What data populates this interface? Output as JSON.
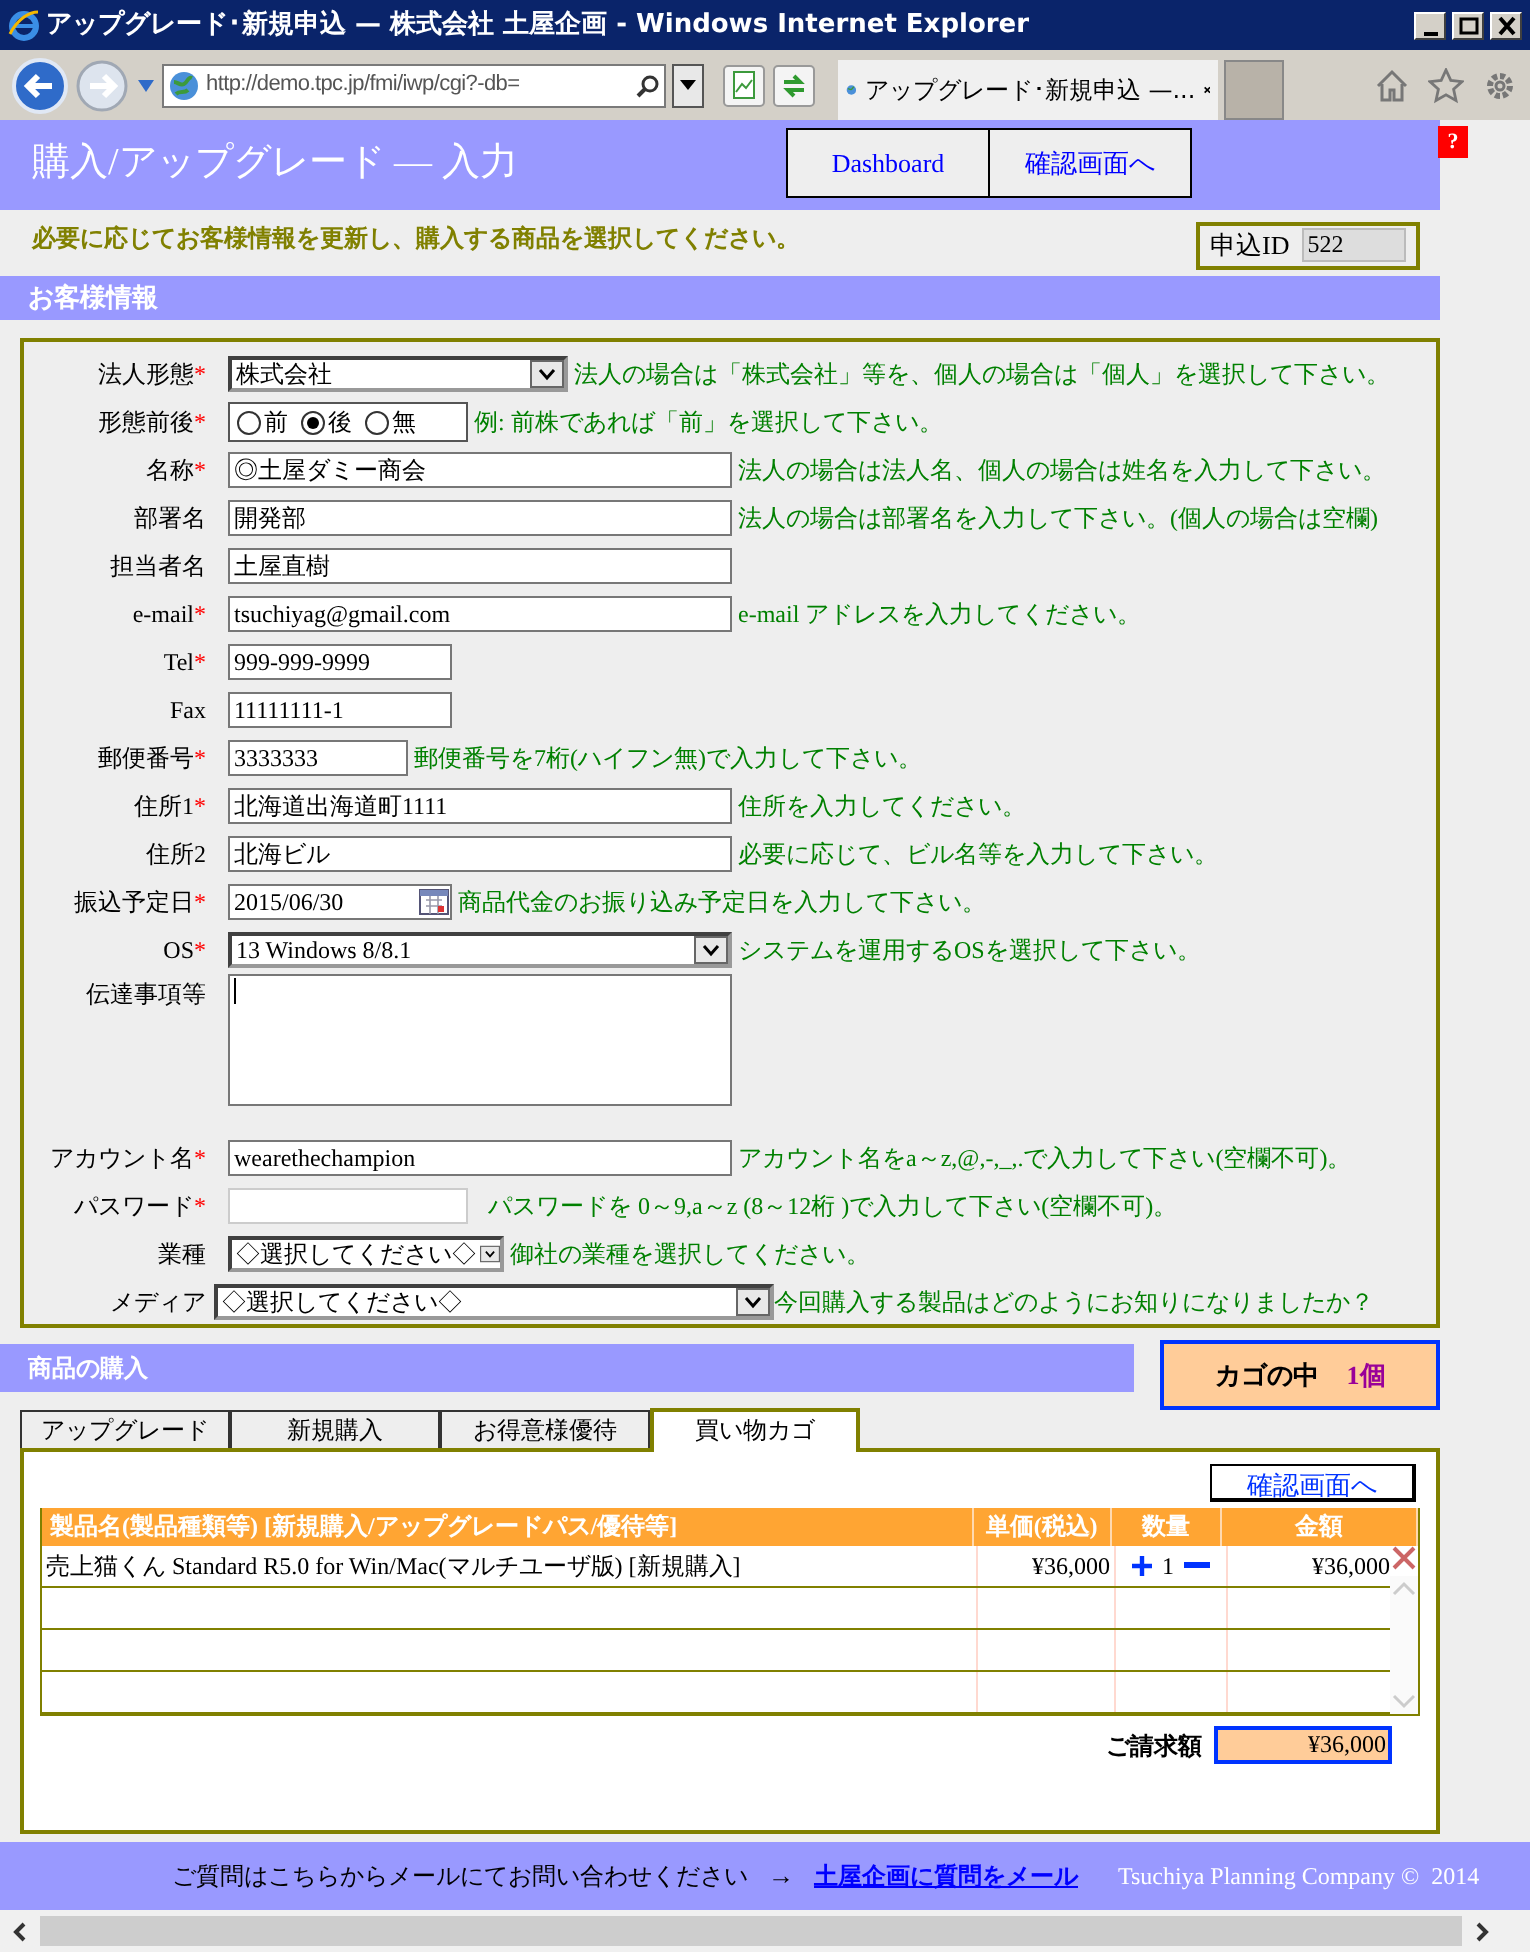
{
  "browser": {
    "window_title": "アップグレード･新規申込 — 株式会社 土屋企画 - Windows Internet Explorer",
    "address": "http://demo.tpc.jp/fmi/iwp/cgi?-db=",
    "tab_title": "アップグレード･新規申込 —..."
  },
  "header": {
    "title": "購入/アップグレード — 入力",
    "buttons": [
      "Dashboard",
      "確認画面へ"
    ],
    "help_icon": "?"
  },
  "instruction": "必要に応じてお客様情報を更新し、購入する商品を選択してください。",
  "application_id": {
    "label": "申込ID",
    "value": "522"
  },
  "customer_section": {
    "title": "お客様情報",
    "required_mark": "*",
    "fields": [
      {
        "kind": "select",
        "label": "法人形態",
        "required": true,
        "value": "株式会社",
        "hint": "法人の場合は「株式会社」等を、個人の場合は「個人」を選択して下さい。"
      },
      {
        "kind": "radio",
        "label": "形態前後",
        "required": true,
        "options": [
          {
            "label": "前",
            "selected": false
          },
          {
            "label": "後",
            "selected": true
          },
          {
            "label": "無",
            "selected": false
          }
        ],
        "hint": "例: 前株であれば「前」を選択して下さい。"
      },
      {
        "kind": "text",
        "label": "名称",
        "required": true,
        "value": "◎土屋ダミー商会",
        "hint": "法人の場合は法人名、個人の場合は姓名を入力して下さい。"
      },
      {
        "kind": "text",
        "label": "部署名",
        "required": false,
        "value": "開発部",
        "hint": "法人の場合は部署名を入力して下さい。(個人の場合は空欄)"
      },
      {
        "kind": "text",
        "label": "担当者名",
        "required": false,
        "value": "土屋直樹"
      },
      {
        "kind": "text",
        "label": "e-mail",
        "required": true,
        "value": "tsuchiyag@gmail.com",
        "hint": "e-mail アドレスを入力してください。"
      },
      {
        "kind": "text",
        "label": "Tel",
        "required": true,
        "value": "999-999-9999"
      },
      {
        "kind": "text",
        "label": "Fax",
        "required": false,
        "value": "11111111-1"
      },
      {
        "kind": "text",
        "label": "郵便番号",
        "required": true,
        "value": "3333333",
        "hint": "郵便番号を7桁(ハイフン無)で入力して下さい。"
      },
      {
        "kind": "text",
        "label": "住所1",
        "required": true,
        "value": "北海道出海道町1111",
        "hint": "住所を入力してください。"
      },
      {
        "kind": "text",
        "label": "住所2",
        "required": false,
        "value": "北海ビル",
        "hint": "必要に応じて、ビル名等を入力して下さい。"
      },
      {
        "kind": "date",
        "label": "振込予定日",
        "required": true,
        "value": "2015/06/30",
        "hint": "商品代金のお振り込み予定日を入力して下さい。"
      },
      {
        "kind": "select",
        "label": "OS",
        "required": true,
        "value": "13 Windows 8/8.1",
        "hint": "システムを運用するOSを選択して下さい。"
      },
      {
        "kind": "textarea",
        "label": "伝達事項等",
        "required": false,
        "focused": true
      },
      {
        "kind": "text",
        "label": "アカウント名",
        "required": true,
        "value": "wearethechampion",
        "hint": "アカウント名をa～z,@,-,_,.で入力して下さい(空欄不可)。"
      },
      {
        "kind": "password",
        "label": "パスワード",
        "required": true,
        "hint": "パスワードを 0～9,a～z (8～12桁 )で入力して下さい(空欄不可)。"
      },
      {
        "kind": "select",
        "label": "業種",
        "required": false,
        "value": "◇選択してください◇",
        "hint": "御社の業種を選択してください。"
      },
      {
        "kind": "select",
        "label": "メディア",
        "required": false,
        "value": "◇選択してください◇",
        "hint": "今回購入する製品はどのようにお知りになりましたか？"
      }
    ]
  },
  "purchase_section": {
    "title": "商品の購入",
    "cart_summary": {
      "label": "カゴの中",
      "count": "1個"
    },
    "tabs": [
      {
        "label": "アップグレード",
        "selected": false
      },
      {
        "label": "新規購入",
        "selected": false
      },
      {
        "label": "お得意様優待",
        "selected": false
      },
      {
        "label": "買い物カゴ",
        "selected": true
      }
    ],
    "confirm_button": "確認画面へ",
    "table": {
      "columns": [
        "製品名(製品種類等) [新規購入/アップグレードパス/優待等]",
        "単価(税込)",
        "数量",
        "金額"
      ],
      "rows": [
        {
          "product": "売上猫くん Standard R5.0 for Win/Mac(マルチユーザ版) [新規購入]",
          "price": "¥36,000",
          "quantity": "1",
          "amount": "¥36,000"
        }
      ]
    },
    "total": {
      "label": "ご請求額",
      "value": "¥36,000"
    }
  },
  "footer": {
    "text": "ご質問はこちらからメールにてお問い合わせください",
    "arrow": "→",
    "link": "土屋企画に質問をメール",
    "copyright": "Tsuchiya Planning Company ©  2014"
  }
}
